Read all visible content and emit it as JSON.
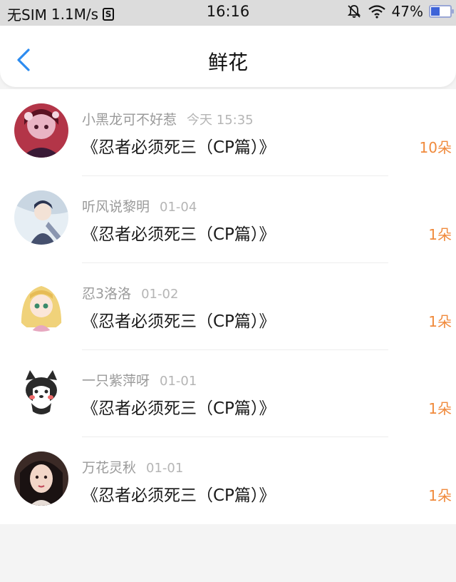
{
  "status_bar": {
    "carrier": "无SIM",
    "speed": "1.1M/s",
    "s_badge": "S",
    "time": "16:16",
    "battery": "47%",
    "icons": [
      "bell-mute-icon",
      "wifi-icon",
      "battery-icon"
    ]
  },
  "nav": {
    "title": "鲜花",
    "back_icon": "chevron-left-icon",
    "accent_color": "#2d8cf0"
  },
  "colors": {
    "count": "#f08a3c",
    "name": "#9a9a9a",
    "time": "#b5b5b5"
  },
  "items": [
    {
      "name": "小黑龙可不好惹",
      "time": "今天 15:35",
      "book": "《忍者必须死三（CP篇）》",
      "count": "10朵",
      "avatar": "avatar-anime-red"
    },
    {
      "name": "听风说黎明",
      "time": "01-04",
      "book": "《忍者必须死三（CP篇）》",
      "count": "1朵",
      "avatar": "avatar-anime-blue"
    },
    {
      "name": "忍3洛洛",
      "time": "01-02",
      "book": "《忍者必须死三（CP篇）》",
      "count": "1朵",
      "avatar": "avatar-anime-blonde"
    },
    {
      "name": "一只紫萍呀",
      "time": "01-01",
      "book": "《忍者必须死三（CP篇）》",
      "count": "1朵",
      "avatar": "avatar-husky"
    },
    {
      "name": "万花灵秋",
      "time": "01-01",
      "book": "《忍者必须死三（CP篇）》",
      "count": "1朵",
      "avatar": "avatar-photo"
    }
  ]
}
